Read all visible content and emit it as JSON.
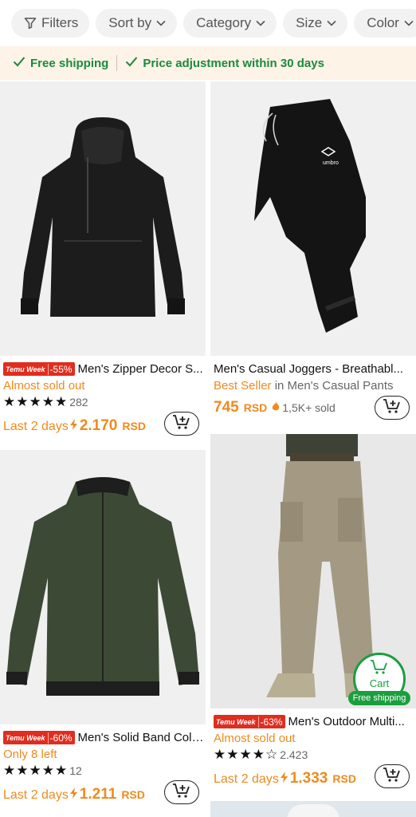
{
  "filters": [
    {
      "label": "Filters",
      "icon": "filter-icon"
    },
    {
      "label": "Sort by",
      "icon": "chevron-down-icon"
    },
    {
      "label": "Category",
      "icon": "chevron-down-icon"
    },
    {
      "label": "Size",
      "icon": "chevron-down-icon"
    },
    {
      "label": "Color",
      "icon": "chevron-down-icon"
    }
  ],
  "banner": {
    "free_shipping": "Free shipping",
    "price_adjustment": "Price adjustment within 30 days"
  },
  "products": [
    {
      "badge_event": "Temu Week",
      "badge_discount": "-55%",
      "title": "Men's Zipper Decor S...",
      "status": "Almost sold out",
      "rating_stars": "★★★★★",
      "rating_count": "282",
      "price_label": "Last 2 days",
      "price": "2.170",
      "currency": "RSD"
    },
    {
      "title": "Men's Casual Joggers - Breathabl...",
      "tag": "Best Seller",
      "tag_suffix": " in Men's Casual Pants",
      "price": "745",
      "currency": "RSD",
      "sold": "1,5K+ sold",
      "image_logo": "umbro"
    },
    {
      "badge_event": "Temu Week",
      "badge_discount": "-60%",
      "title": "Men's Solid Band Coll...",
      "status": "Only 8 left",
      "rating_stars": "★★★★★",
      "rating_count": "12",
      "price_label": "Last 2 days",
      "price": "1.211",
      "currency": "RSD"
    },
    {
      "badge_event": "Temu Week",
      "badge_discount": "-63%",
      "title": "Men's Outdoor Multi...",
      "status": "Almost sold out",
      "rating_stars": "★★★★☆",
      "rating_count": "2.423",
      "price_label": "Last 2 days",
      "price": "1.333",
      "currency": "RSD"
    }
  ],
  "floating_cart": {
    "label": "Cart",
    "badge": "Free shipping"
  },
  "colors": {
    "accent_orange": "#f08a1c",
    "badge_red": "#e02d1f",
    "green": "#1b8a3a"
  }
}
